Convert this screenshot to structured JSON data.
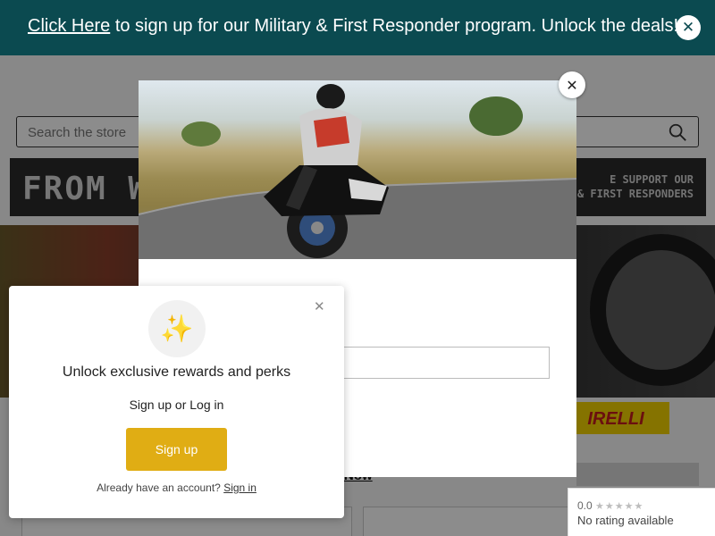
{
  "announcement": {
    "link_text": "Click Here",
    "text": "to sign up for our Military & First Responder program. Unlock the deals!",
    "close_icon": "close-icon"
  },
  "header": {
    "search_placeholder": "Search the store",
    "search_icon": "search-icon"
  },
  "promo_banner": {
    "left_text": "FROM W",
    "right_line1": "E SUPPORT OUR",
    "right_line2": "& FIRST RESPONDERS"
  },
  "brand_banner": {
    "text": "IRELLI"
  },
  "content": {
    "shop_link": "Now"
  },
  "modal": {
    "close_icon": "close-icon",
    "image_alt": "motorcycle-rider-photo"
  },
  "rewards": {
    "icon": "sparkles-icon",
    "title": "Unlock exclusive rewards and perks",
    "subtitle": "Sign up or Log in",
    "signup_label": "Sign up",
    "footer_text": "Already have an account?",
    "signin_link": "Sign in",
    "close_icon": "close-icon"
  },
  "google_badge": {
    "score": "0.0",
    "stars": "★★★★★",
    "label": "No rating available"
  },
  "colors": {
    "topbar": "#0b4a50",
    "accent": "#e0ad14",
    "pirelli_yellow": "#f2d100"
  }
}
